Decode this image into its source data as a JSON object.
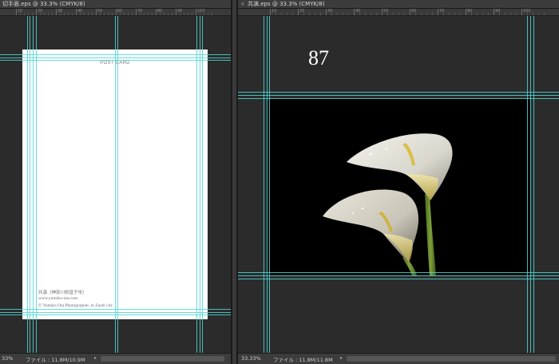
{
  "left_doc": {
    "tab_title": "切手面.eps @ 33.3% (CMYK/8)",
    "ruler_labels": [
      "10",
      "20",
      "30",
      "40",
      "50",
      "60",
      "70",
      "80",
      "90",
      "100"
    ],
    "header_text": "POST CARD",
    "credit_line1": "共演（神奈川県逗子市）",
    "credit_line2": "www.yumiko-ota.com",
    "credit_line3": "© Yumiko Ota Photographer, in Zushi city",
    "status_zoom": "33%",
    "status_file": "ファイル : 11.8M/10.9M"
  },
  "right_doc": {
    "tab_close": "×",
    "tab_title": "共演.eps @ 33.3% (CMYK/8)",
    "ruler_labels": [
      "10",
      "20",
      "30",
      "40",
      "50",
      "60",
      "70",
      "80",
      "90",
      "100"
    ],
    "page_number": "87",
    "photo_subject": "white calla lilies on black background",
    "status_zoom": "33.33%",
    "status_file": "ファイル : 11.8M/11.8M"
  },
  "colors": {
    "guide": "#4fd6d6",
    "workspace": "#2b2b2b",
    "chrome": "#3c3c3c"
  },
  "icons": {
    "close": "close-icon",
    "status_arrow": "chevron-right-icon"
  }
}
